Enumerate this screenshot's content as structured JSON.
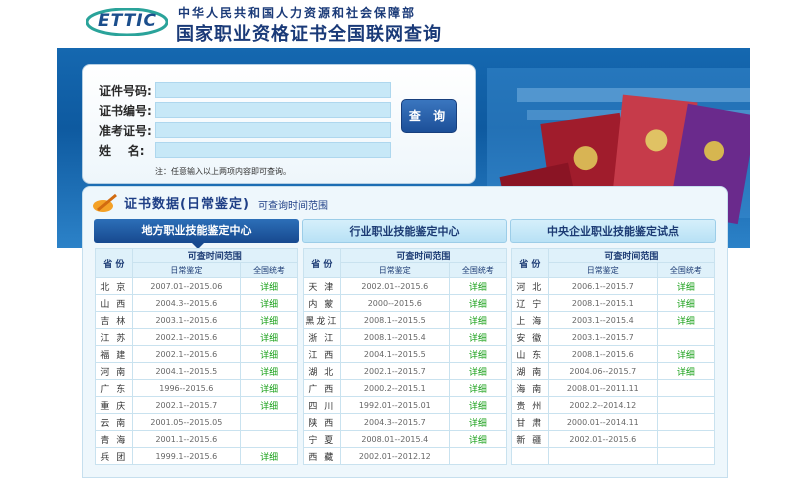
{
  "header": {
    "logo_text": "ETTIC",
    "org_name": "中华人民共和国人力资源和社会保障部",
    "title": "国家职业资格证书全国联网查询"
  },
  "form": {
    "fields": [
      {
        "label": "证件号码:",
        "value": ""
      },
      {
        "label": "证书编号:",
        "value": ""
      },
      {
        "label": "准考证号:",
        "value": ""
      },
      {
        "label": "姓    名:",
        "value": ""
      }
    ],
    "note": "注：任意输入以上两项内容即可查询。",
    "query_button": "查 询"
  },
  "section": {
    "title": "证书数据(日常鉴定)",
    "subtitle": "可查询时间范围"
  },
  "tabs": [
    {
      "label": "地方职业技能鉴定中心",
      "active": true
    },
    {
      "label": "行业职业技能鉴定中心",
      "active": false
    },
    {
      "label": "中央企业职业技能鉴定试点",
      "active": false
    }
  ],
  "table_headers": {
    "province": "省 份",
    "range": "可查时间范围",
    "daily": "日常鉴定",
    "national": "全国统考"
  },
  "table_columns": [
    [
      {
        "province": "北 京",
        "daily": "2007.01--2015.06",
        "national": "详细"
      },
      {
        "province": "山 西",
        "daily": "2004.3--2015.6",
        "national": "详细"
      },
      {
        "province": "吉 林",
        "daily": "2003.1--2015.6",
        "national": "详细"
      },
      {
        "province": "江 苏",
        "daily": "2002.1--2015.6",
        "national": "详细"
      },
      {
        "province": "福 建",
        "daily": "2002.1--2015.6",
        "national": "详细"
      },
      {
        "province": "河 南",
        "daily": "2004.1--2015.5",
        "national": "详细"
      },
      {
        "province": "广 东",
        "daily": "1996--2015.6",
        "national": "详细"
      },
      {
        "province": "重 庆",
        "daily": "2002.1--2015.7",
        "national": "详细"
      },
      {
        "province": "云 南",
        "daily": "2001.05--2015.05",
        "national": ""
      },
      {
        "province": "青 海",
        "daily": "2001.1--2015.6",
        "national": ""
      },
      {
        "province": "兵 团",
        "daily": "1999.1--2015.6",
        "national": "详细"
      }
    ],
    [
      {
        "province": "天 津",
        "daily": "2002.01--2015.6",
        "national": "详细"
      },
      {
        "province": "内 蒙",
        "daily": "2000--2015.6",
        "national": "详细"
      },
      {
        "province": "黑龙江",
        "daily": "2008.1--2015.5",
        "national": "详细"
      },
      {
        "province": "浙 江",
        "daily": "2008.1--2015.4",
        "national": "详细"
      },
      {
        "province": "江 西",
        "daily": "2004.1--2015.5",
        "national": "详细"
      },
      {
        "province": "湖 北",
        "daily": "2002.1--2015.7",
        "national": "详细"
      },
      {
        "province": "广 西",
        "daily": "2000.2--2015.1",
        "national": "详细"
      },
      {
        "province": "四 川",
        "daily": "1992.01--2015.01",
        "national": "详细"
      },
      {
        "province": "陕 西",
        "daily": "2004.3--2015.7",
        "national": "详细"
      },
      {
        "province": "宁 夏",
        "daily": "2008.01--2015.4",
        "national": "详细"
      },
      {
        "province": "西 藏",
        "daily": "2002.01--2012.12",
        "national": ""
      }
    ],
    [
      {
        "province": "河 北",
        "daily": "2006.1--2015.7",
        "national": "详细"
      },
      {
        "province": "辽 宁",
        "daily": "2008.1--2015.1",
        "national": "详细"
      },
      {
        "province": "上 海",
        "daily": "2003.1--2015.4",
        "national": "详细"
      },
      {
        "province": "安 徽",
        "daily": "2003.1--2015.7",
        "national": ""
      },
      {
        "province": "山 东",
        "daily": "2008.1--2015.6",
        "national": "详细"
      },
      {
        "province": "湖 南",
        "daily": "2004.06--2015.7",
        "national": "详细"
      },
      {
        "province": "海 南",
        "daily": "2008.01--2011.11",
        "national": ""
      },
      {
        "province": "贵 州",
        "daily": "2002.2--2014.12",
        "national": ""
      },
      {
        "province": "甘 肃",
        "daily": "2000.01--2014.11",
        "national": ""
      },
      {
        "province": "新 疆",
        "daily": "2002.01--2015.6",
        "national": ""
      }
    ]
  ],
  "colors": {
    "brand_blue": "#1a3a78",
    "banner_blue": "#1568b0",
    "link_green": "#1aa11a"
  }
}
